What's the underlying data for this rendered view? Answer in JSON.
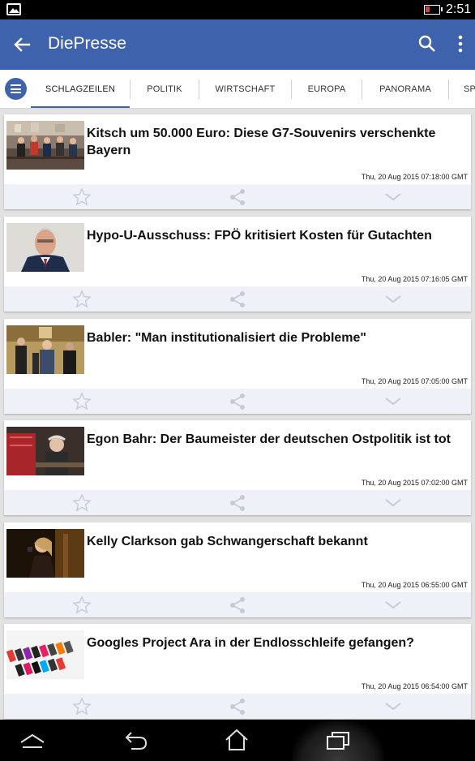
{
  "status_bar": {
    "time": "2:51",
    "notification_icon": "picture-icon",
    "battery_color": "#e53935"
  },
  "app_bar": {
    "title": "DiePresse",
    "background": "#3f62ad",
    "icons": [
      "back-arrow-icon",
      "search-icon",
      "overflow-menu-icon"
    ]
  },
  "tabs": [
    {
      "label": "SCHLAGZEILEN",
      "active": true
    },
    {
      "label": "POLITIK",
      "active": false
    },
    {
      "label": "WIRTSCHAFT",
      "active": false
    },
    {
      "label": "EUROPA",
      "active": false
    },
    {
      "label": "PANORAMA",
      "active": false
    },
    {
      "label": "SP",
      "active": false
    }
  ],
  "articles": [
    {
      "headline": "Kitsch um 50.000 Euro: Diese G7-Souvenirs verschenkte Bayern",
      "date": "Thu, 20 Aug 2015 07:18:00 GMT"
    },
    {
      "headline": "Hypo-U-Ausschuss: FPÖ kritisiert Kosten für Gutachten",
      "date": "Thu, 20 Aug 2015 07:16:05 GMT"
    },
    {
      "headline": "Babler: \"Man institutionalisiert die Probleme\"",
      "date": "Thu, 20 Aug 2015 07:05:00 GMT"
    },
    {
      "headline": "Egon Bahr: Der Baumeister der deutschen Ostpolitik ist tot",
      "date": "Thu, 20 Aug 2015 07:02:00 GMT"
    },
    {
      "headline": "Kelly Clarkson gab Schwangerschaft bekannt",
      "date": "Thu, 20 Aug 2015 06:55:00 GMT"
    },
    {
      "headline": "Googles Project Ara in der Endlosschleife gefangen?",
      "date": "Thu, 20 Aug 2015 06:54:00 GMT"
    }
  ],
  "card_actions": [
    "star-icon",
    "share-icon",
    "chevron-down-icon"
  ],
  "nav_bar": [
    "menu-up-icon",
    "back-icon",
    "home-icon",
    "recent-apps-icon"
  ]
}
